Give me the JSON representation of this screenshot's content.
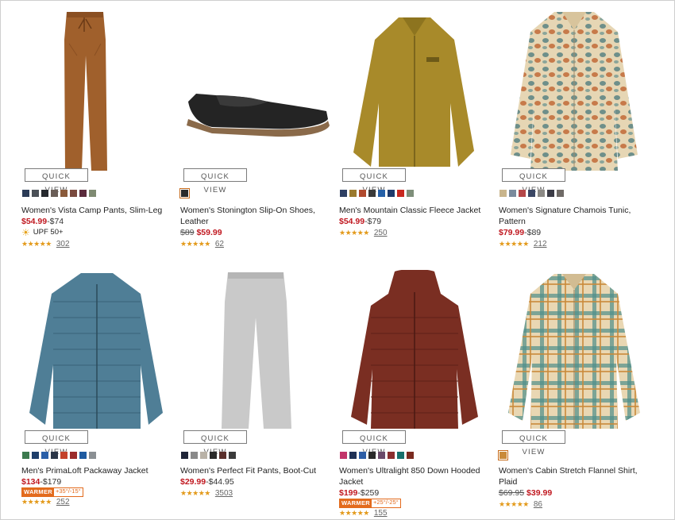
{
  "quick_view_label": "QUICK VIEW",
  "products": [
    {
      "title": "Women's Vista Camp Pants, Slim-Leg",
      "sale": "$54.99",
      "rest": "-$74",
      "strike": "",
      "tag": "UPF 50+",
      "rating_count": "302",
      "stars": "★★★★★",
      "swatches": [
        "#2b3b57",
        "#4b5057",
        "#26292e",
        "#6a5e57",
        "#8a5a3a",
        "#7a4a3f",
        "#5b2b3c",
        "#7f8a72"
      ]
    },
    {
      "title": "Women's Stonington Slip-On Shoes, Leather",
      "sale": "$59.99",
      "rest": "",
      "strike": "$89",
      "tag": "",
      "rating_count": "62",
      "stars": "★★★★★",
      "swatches": [
        "#2a2a2a"
      ]
    },
    {
      "title": "Men's Mountain Classic Fleece Jacket",
      "sale": "$54.99",
      "rest": "-$79",
      "strike": "",
      "tag": "",
      "rating_count": "250",
      "stars": "★★★★★",
      "swatches": [
        "#2e3f63",
        "#9b7a2e",
        "#b04a2e",
        "#3a3a3a",
        "#2560a8",
        "#1f3a6b",
        "#c8281f",
        "#7e8f7a"
      ]
    },
    {
      "title": "Women's Signature Chamois Tunic, Pattern",
      "sale": "$79.99",
      "rest": "-$89",
      "strike": "",
      "tag": "",
      "rating_count": "212",
      "stars": "★★★★★",
      "swatches": [
        "#c9b58d",
        "#7a8a9c",
        "#b5484a",
        "#3a4664",
        "#8c8a86",
        "#3b3b46",
        "#6f6a66"
      ]
    },
    {
      "title": "Men's PrimaLoft Packaway Jacket",
      "sale": "$134",
      "rest": "-$179",
      "strike": "",
      "warmer": "WARMER",
      "warm_range": "+35°/-15°",
      "rating_count": "252",
      "stars": "★★★★★",
      "swatches": [
        "#3c7a4e",
        "#1e3e6a",
        "#2a5fa8",
        "#2b3547",
        "#c4412a",
        "#9b2b2b",
        "#1e5aa0",
        "#8a8f93"
      ]
    },
    {
      "title": "Women's Perfect Fit Pants, Boot-Cut",
      "sale": "$29.99",
      "rest": "-$44.95",
      "strike": "",
      "tag": "",
      "rating_count": "3503",
      "stars": "★★★★★",
      "swatches": [
        "#1f2538",
        "#8a8a8a",
        "#b9b2a7",
        "#2b2b2b",
        "#5a2f2b",
        "#3b3b3b"
      ]
    },
    {
      "title": "Women's Ultralight 850 Down Hooded Jacket",
      "sale": "$199",
      "rest": "-$259",
      "strike": "",
      "warmer": "WARMER",
      "warm_range": "+25°/-25°",
      "rating_count": "155",
      "stars": "★★★★★",
      "swatches": [
        "#c2346a",
        "#1f3156",
        "#2d5ea6",
        "#2a2a2a",
        "#6a4a6a",
        "#8a2e2e",
        "#166f6b",
        "#7a2a1f"
      ]
    },
    {
      "title": "Women's Cabin Stretch Flannel Shirt, Plaid",
      "sale": "$39.99",
      "rest": "",
      "strike": "$69.95",
      "tag": "",
      "rating_count": "86",
      "stars": "★★★★★",
      "swatches": [
        "#c98a3a"
      ]
    }
  ]
}
